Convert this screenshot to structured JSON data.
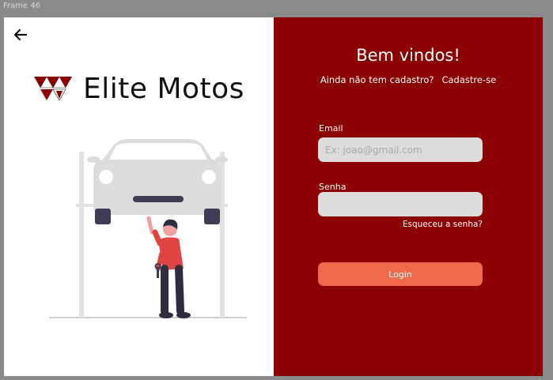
{
  "frame": {
    "label": "Frame 46"
  },
  "left": {
    "back_icon": "arrow-left-icon",
    "brand": {
      "name": "Elite Motos",
      "logo_icon": "triangles-logo-icon"
    },
    "illustration": "mechanic-under-car-lift-illustration"
  },
  "right": {
    "title": "Bem vindos!",
    "signup_question": "Ainda não tem cadastro?",
    "signup_link": "Cadastre-se",
    "email_label": "Email",
    "email_placeholder": "Ex: joao@gmail.com",
    "email_value": "",
    "password_label": "Senha",
    "password_value": "",
    "forgot_link": "Esqueceu a senha?",
    "login_label": "Login"
  },
  "colors": {
    "brand_red": "#8b0000",
    "accent": "#ee6a4a",
    "input_bg": "#dcdcdc"
  }
}
